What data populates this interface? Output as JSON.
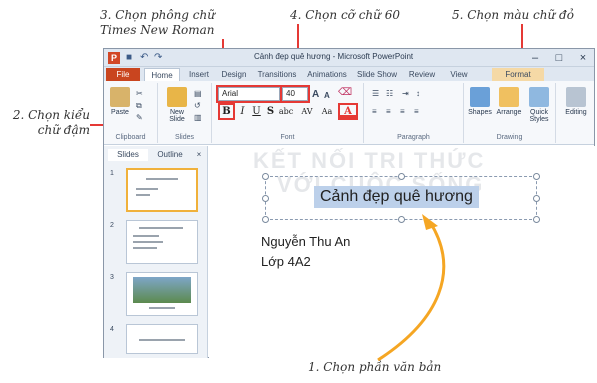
{
  "callouts": {
    "c1": "1. Chọn phần văn bản",
    "c2_line1": "2. Chọn kiểu",
    "c2_line2": "chữ đậm",
    "c3_line1": "3. Chọn phông chữ",
    "c3_line2": "Times New Roman",
    "c4": "4. Chọn cỡ chữ 60",
    "c5": "5. Chọn màu chữ đỏ"
  },
  "window": {
    "title": "Cảnh đẹp quê hương - Microsoft PowerPoint",
    "app_icon": "P",
    "minimize": "–",
    "maximize": "□",
    "close": "×"
  },
  "tabs": [
    "File",
    "Home",
    "Insert",
    "Design",
    "Transitions",
    "Animations",
    "Slide Show",
    "Review",
    "View",
    "Format"
  ],
  "ribbon": {
    "paste": "Paste",
    "new_slide_line1": "New",
    "new_slide_line2": "Slide",
    "clipboard": "Clipboard",
    "slides": "Slides",
    "font_name": "Arial",
    "font_size": "40",
    "grow": "A",
    "shrink": "A",
    "bold": "B",
    "italic": "I",
    "underline": "U",
    "strike": "S",
    "shadow": "abc",
    "spacing": "AV",
    "case": "Aa",
    "color": "A",
    "font_group": "Font",
    "paragraph_group": "Paragraph",
    "shapes": "Shapes",
    "arrange": "Arrange",
    "quick_line1": "Quick",
    "quick_line2": "Styles",
    "drawing_group": "Drawing",
    "editing": "Editing"
  },
  "sidepane": {
    "tab_slides": "Slides",
    "tab_outline": "Outline",
    "thumb_numbers": [
      "1",
      "2",
      "3",
      "4"
    ]
  },
  "slide": {
    "title": "Cảnh đẹp quê hương",
    "line1": "Nguyễn Thu An",
    "line2": "Lớp 4A2"
  },
  "colors": {
    "highlight": "#e53935",
    "arrow": "#f5a623",
    "file_tab": "#c9451f",
    "selection": "#bcd0ea"
  }
}
